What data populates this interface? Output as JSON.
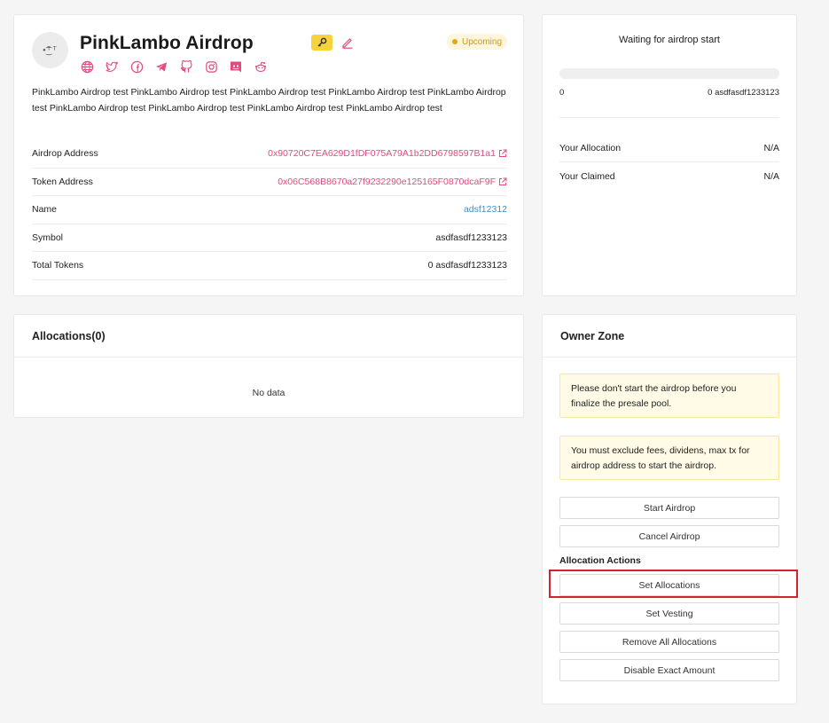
{
  "airdrop": {
    "title": "PinkLambo Airdrop",
    "avatar_text": "•͜͡ᵀᵀ",
    "status": "Upcoming",
    "description": "PinkLambo Airdrop test PinkLambo Airdrop test PinkLambo Airdrop test PinkLambo Airdrop test PinkLambo Airdrop test PinkLambo Airdrop test PinkLambo Airdrop test PinkLambo Airdrop test PinkLambo Airdrop test",
    "socials": [
      "globe-icon",
      "twitter-icon",
      "facebook-icon",
      "telegram-icon",
      "github-icon",
      "instagram-icon",
      "discord-icon",
      "reddit-icon"
    ],
    "rows": [
      {
        "label": "Airdrop Address",
        "value": "0x90720C7EA629D1fDF075A79A1b2DD6798597B1a1"
      },
      {
        "label": "Token Address",
        "value": "0x06C568B8670a27f9232290e125165F0870dcaF9F"
      },
      {
        "label": "Name",
        "value": "adsf12312"
      },
      {
        "label": "Symbol",
        "value": "asdfasdf1233123"
      },
      {
        "label": "Total Tokens",
        "value": "0 asdfasdf1233123"
      }
    ]
  },
  "status_card": {
    "title": "Waiting for airdrop start",
    "progress_fraction": 0,
    "progress_left": "0",
    "progress_right": "0 asdfasdf1233123",
    "allocation_label": "Your Allocation",
    "allocation_value": "N/A",
    "claimed_label": "Your Claimed",
    "claimed_value": "N/A"
  },
  "allocations": {
    "title": "Allocations(0)",
    "empty_text": "No data"
  },
  "owner_zone": {
    "title": "Owner Zone",
    "alert1": "Please don't start the airdrop before you finalize the presale pool.",
    "alert2": "You must exclude fees, dividens, max tx for airdrop address to start the airdrop.",
    "start_label": "Start Airdrop",
    "cancel_label": "Cancel Airdrop",
    "section_label": "Allocation Actions",
    "set_alloc_label": "Set Allocations",
    "vesting_label": "Set Vesting",
    "remove_label": "Remove All Allocations",
    "disable_label": "Disable Exact Amount"
  },
  "colors": {
    "accent": "#e04a7f",
    "link_blue": "#3a8fd0",
    "badge_text": "#d19a10",
    "highlight": "#d3232f"
  }
}
